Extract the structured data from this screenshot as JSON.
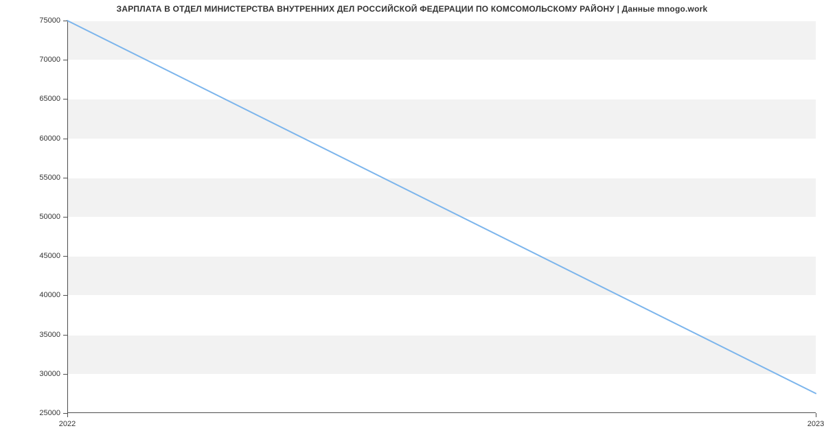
{
  "chart_data": {
    "type": "line",
    "title": "ЗАРПЛАТА В ОТДЕЛ МИНИСТЕРСТВА ВНУТРЕННИХ ДЕЛ РОССИЙСКОЙ ФЕДЕРАЦИИ ПО КОМСОМОЛЬСКОМУ РАЙОНУ | Данные mnogo.work",
    "xlabel": "",
    "ylabel": "",
    "categories": [
      "2022",
      "2023"
    ],
    "x": [
      2022,
      2023
    ],
    "values": [
      75000,
      27500
    ],
    "ylim": [
      25000,
      75000
    ],
    "y_ticks": [
      25000,
      30000,
      35000,
      40000,
      45000,
      50000,
      55000,
      60000,
      65000,
      70000,
      75000
    ],
    "x_ticks": [
      "2022",
      "2023"
    ],
    "line_color": "#7cb5ec",
    "grid": true
  }
}
